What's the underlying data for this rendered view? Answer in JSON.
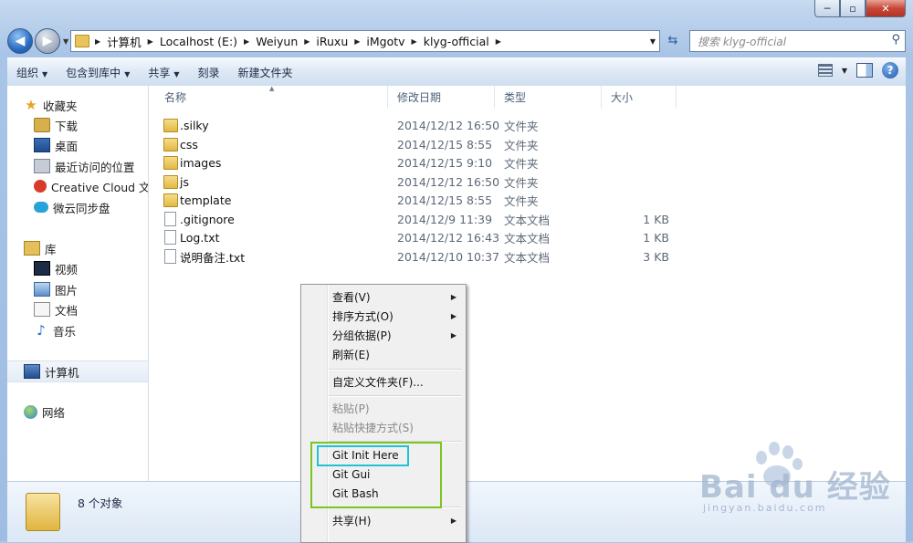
{
  "window": {
    "caption_buttons": {
      "minimize": "─",
      "maximize": "▫",
      "close": "✕"
    }
  },
  "address_bar": {
    "crumbs": [
      "计算机",
      "Localhost (E:)",
      "Weiyun",
      "iRuxu",
      "iMgotv",
      "klyg-official"
    ]
  },
  "search": {
    "placeholder": "搜索 klyg-official"
  },
  "toolbar": {
    "organize": "组织",
    "include_library": "包含到库中",
    "share": "共享",
    "burn": "刻录",
    "new_folder": "新建文件夹"
  },
  "nav_pane": {
    "favorites": {
      "label": "收藏夹",
      "items": [
        "下载",
        "桌面",
        "最近访问的位置",
        "Creative Cloud 文件",
        "微云同步盘"
      ]
    },
    "libraries": {
      "label": "库",
      "items": [
        "视频",
        "图片",
        "文档",
        "音乐"
      ]
    },
    "computer": "计算机",
    "network": "网络"
  },
  "columns": {
    "name": "名称",
    "modified": "修改日期",
    "type": "类型",
    "size": "大小"
  },
  "files": [
    {
      "name": ".silky",
      "modified": "2014/12/12 16:50",
      "type": "文件夹",
      "size": ""
    },
    {
      "name": "css",
      "modified": "2014/12/15 8:55",
      "type": "文件夹",
      "size": ""
    },
    {
      "name": "images",
      "modified": "2014/12/15 9:10",
      "type": "文件夹",
      "size": ""
    },
    {
      "name": "js",
      "modified": "2014/12/12 16:50",
      "type": "文件夹",
      "size": ""
    },
    {
      "name": "template",
      "modified": "2014/12/15 8:55",
      "type": "文件夹",
      "size": ""
    },
    {
      "name": ".gitignore",
      "modified": "2014/12/9 11:39",
      "type": "文本文档",
      "size": "1 KB"
    },
    {
      "name": "Log.txt",
      "modified": "2014/12/12 16:43",
      "type": "文本文档",
      "size": "1 KB"
    },
    {
      "name": "说明备注.txt",
      "modified": "2014/12/10 10:37",
      "type": "文本文档",
      "size": "3 KB"
    }
  ],
  "details": {
    "count": "8 个对象"
  },
  "context_menu": {
    "view": "查看(V)",
    "sort": "排序方式(O)",
    "group": "分组依据(P)",
    "refresh": "刷新(E)",
    "customize": "自定义文件夹(F)...",
    "paste": "粘贴(P)",
    "paste_shortcut": "粘贴快捷方式(S)",
    "git_init": "Git Init Here",
    "git_gui": "Git Gui",
    "git_bash": "Git Bash",
    "share": "共享(H)"
  },
  "watermark": {
    "brand": "Bai  du 经验",
    "site": "jingyan.baidu.com"
  },
  "colors": {
    "highlight_green": "#7cc520",
    "highlight_cyan": "#1ec3d8",
    "accent_blue": "#2a6cc0"
  }
}
